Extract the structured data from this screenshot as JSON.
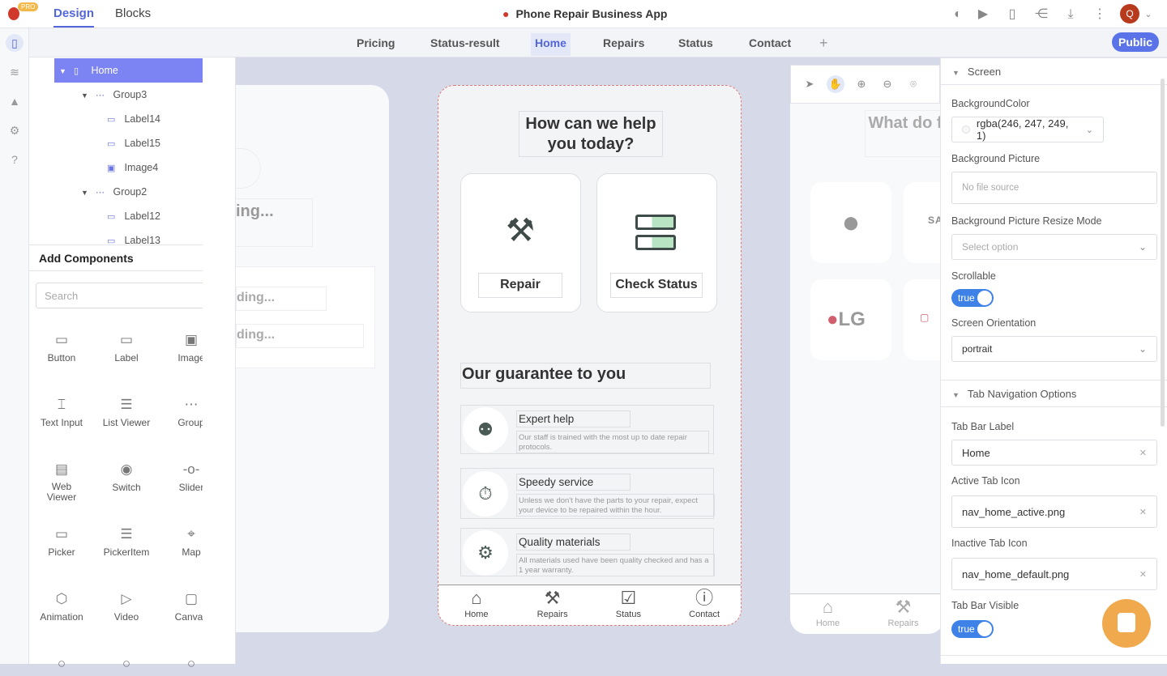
{
  "topbar": {
    "badge": "PRO",
    "tabs": [
      "Design",
      "Blocks"
    ],
    "title": "Phone Repair Business App",
    "avatar": "Q"
  },
  "screens": {
    "tabs": [
      "Pricing",
      "Status-result",
      "Home",
      "Repairs",
      "Status",
      "Contact"
    ],
    "add": "+",
    "active": "Home",
    "public_label": "Public"
  },
  "tree": [
    {
      "label": "Home",
      "icon": "phone-icon"
    },
    {
      "label": "Group3",
      "icon": "group-icon"
    },
    {
      "label": "Label14",
      "icon": "label-icon"
    },
    {
      "label": "Label15",
      "icon": "label-icon"
    },
    {
      "label": "Image4",
      "icon": "image-icon"
    },
    {
      "label": "Group2",
      "icon": "group-icon"
    },
    {
      "label": "Label12",
      "icon": "label-icon"
    },
    {
      "label": "Label13",
      "icon": "label-icon"
    }
  ],
  "add_components": {
    "title": "Add Components",
    "search_placeholder": "Search",
    "items": [
      "Button",
      "Label",
      "Image",
      "Text Input",
      "List Viewer",
      "Group",
      "Web Viewer",
      "Switch",
      "Slider",
      "Picker",
      "PickerItem",
      "Map",
      "Animation",
      "Video",
      "Canvas"
    ]
  },
  "left_phone": {
    "texts": [
      "ing...",
      "ding...",
      "ding..."
    ]
  },
  "phone": {
    "heading": "How can we help you today?",
    "cards": [
      "Repair",
      "Check Status"
    ],
    "guarantee": "Our guarantee to you",
    "rows": [
      {
        "title": "Expert help",
        "desc": "Our staff is trained with the most up to date repair protocols."
      },
      {
        "title": "Speedy service",
        "desc": "Unless we don't have the parts to your repair, expect your device to be repaired within the hour."
      },
      {
        "title": "Quality materials",
        "desc": "All materials used have been quality checked and has a 1 year warranty."
      }
    ],
    "tabbar": [
      "Home",
      "Repairs",
      "Status",
      "Contact"
    ]
  },
  "right_phone": {
    "heading": "What do fixed",
    "brands": [
      "SAM",
      "LG"
    ],
    "tabbar": [
      "Home",
      "Repairs"
    ]
  },
  "props": {
    "screen_section": "Screen",
    "bg_color_label": "BackgroundColor",
    "bg_color": "rgba(246, 247, 249, 1)",
    "bg_picture_label": "Background Picture",
    "bg_picture_placeholder": "No file source",
    "resize_label": "Background Picture Resize Mode",
    "resize_placeholder": "Select option",
    "scrollable_label": "Scrollable",
    "scrollable": "true",
    "orientation_label": "Screen Orientation",
    "orientation": "portrait",
    "tab_section": "Tab Navigation Options",
    "tab_label_label": "Tab Bar Label",
    "tab_label": "Home",
    "active_icon_label": "Active Tab Icon",
    "active_icon": "nav_home_active.png",
    "inactive_icon_label": "Inactive Tab Icon",
    "inactive_icon": "nav_home_default.png",
    "visible_label": "Tab Bar Visible",
    "visible": "true"
  },
  "colors": {
    "accent": "#5466d8",
    "selected_tree": "#7c83f2",
    "toggle": "#3e82e8",
    "chat": "#f0a94c",
    "canvas": "#d6dae8"
  }
}
